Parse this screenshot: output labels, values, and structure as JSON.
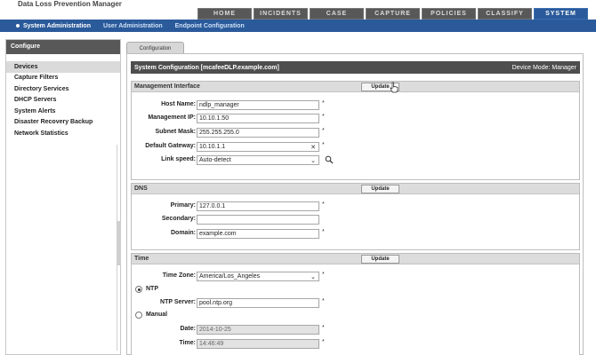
{
  "app": {
    "title": "Data Loss Prevention Manager"
  },
  "main_tabs": [
    "HOME",
    "INCIDENTS",
    "CASE",
    "CAPTURE",
    "POLICIES",
    "CLASSIFY",
    "SYSTEM"
  ],
  "sub_nav": [
    "System Administration",
    "User Administration",
    "Endpoint Configuration"
  ],
  "sidebar": {
    "title": "Configure",
    "items": [
      "Devices",
      "Capture Filters",
      "Directory Services",
      "DHCP Servers",
      "System Alerts",
      "Disaster Recovery Backup",
      "Network Statistics"
    ]
  },
  "content_tab": "Configuration",
  "config_bar": {
    "title": "System Configuration [mcafeeDLP.example.com]",
    "mode": "Device Mode: Manager"
  },
  "update_label": "Update",
  "required_mark": "*",
  "management": {
    "title": "Management Interface",
    "host_name_label": "Host Name:",
    "host_name": "ndlp_manager",
    "ip_label": "Management IP:",
    "ip": "10.10.1.50",
    "mask_label": "Subnet Mask:",
    "mask": "255.255.255.0",
    "gateway_label": "Default Gateway:",
    "gateway": "10.10.1.1",
    "speed_label": "Link speed:",
    "speed": "Auto-detect"
  },
  "dns": {
    "title": "DNS",
    "primary_label": "Primary:",
    "primary": "127.0.0.1",
    "secondary_label": "Secondary:",
    "secondary": "",
    "domain_label": "Domain:",
    "domain": "example.com"
  },
  "time": {
    "title": "Time",
    "zone_label": "Time Zone:",
    "zone": "America/Los_Angeles",
    "ntp_label": "NTP",
    "ntp_server_label": "NTP Server:",
    "ntp_server": "pool.ntp.org",
    "manual_label": "Manual",
    "date_label": "Date:",
    "date": "2014-10-25",
    "time_label": "Time:",
    "time_value": "14:46:49"
  }
}
